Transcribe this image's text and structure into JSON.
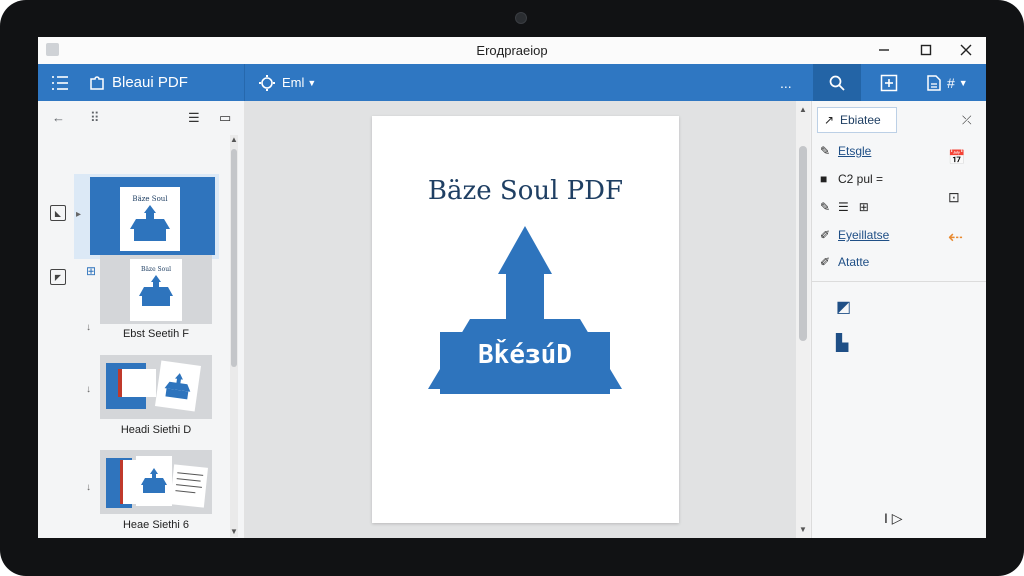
{
  "window": {
    "title": "Eroдpraeiop"
  },
  "toolbar": {
    "app_name": "Bleaui PDF",
    "view_label": "Eml",
    "more_label": "...",
    "sections_label": "#"
  },
  "thumbnails": [
    {
      "label": "",
      "selected": true
    },
    {
      "label": "Ebst Seetih F",
      "selected": false
    },
    {
      "label": "Headi Siethi D",
      "selected": false
    },
    {
      "label": "Heae Siethi 6",
      "selected": false
    }
  ],
  "document": {
    "title": "Bäze Soul PDF",
    "logo_text": "Bǩéɜ́uD"
  },
  "right_panel": {
    "tool_button": "Ebiatee",
    "items": [
      {
        "icon": "pen-icon",
        "label": "Etsgle"
      },
      {
        "icon": "square-icon",
        "label": "C2 pul ="
      },
      {
        "icon": "pen-icon",
        "label": ""
      },
      {
        "icon": "edit-icon",
        "label": "Eyeillatse"
      },
      {
        "icon": "edit-icon",
        "label": "Atatte"
      }
    ],
    "playback_label": "I ▷"
  },
  "colors": {
    "accent": "#2f77c2",
    "accent_dark": "#2364a6",
    "logo": "#2e74bd",
    "highlight": "#e8892f"
  }
}
